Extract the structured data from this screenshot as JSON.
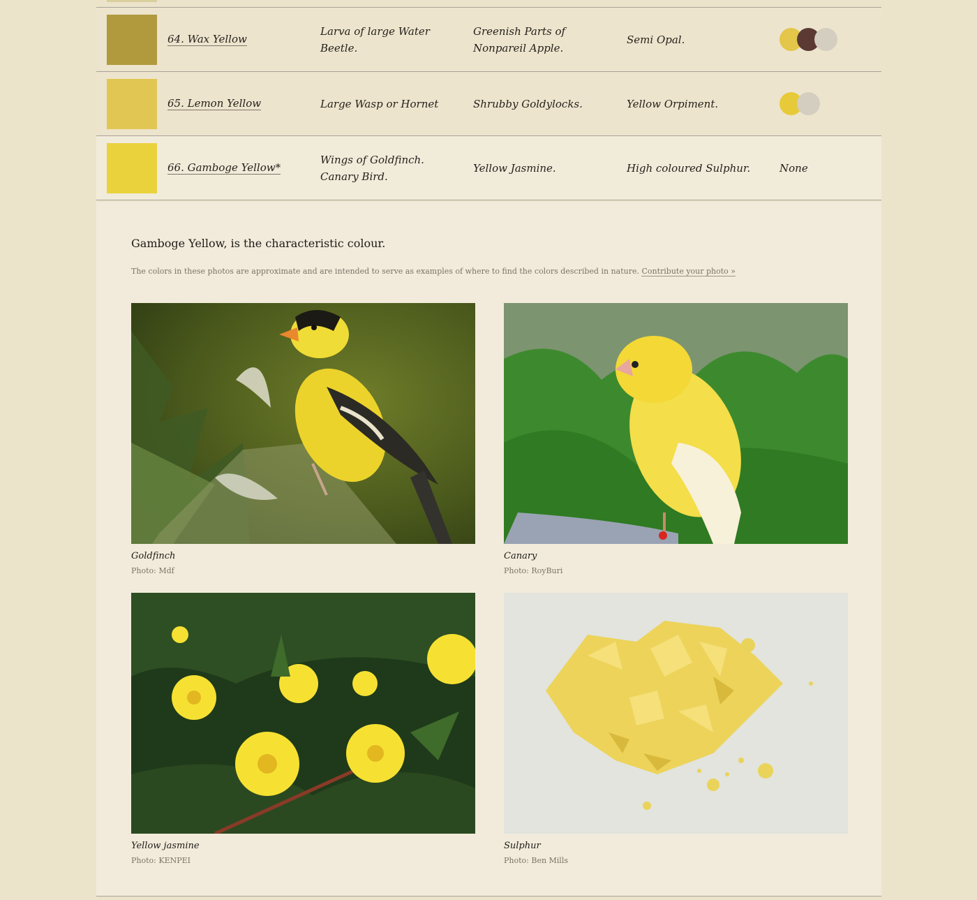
{
  "rows": [
    {
      "number_name": "64. Wax Yellow",
      "swatch_color": "#b09a3d",
      "animal": "Larva of large Water Beetle.",
      "vegetable": "Greenish Parts of Nonpareil Apple.",
      "mineral": "Semi Opal.",
      "dots": [
        "#e3c64a",
        "#5a3a33",
        "#d3cebf"
      ]
    },
    {
      "number_name": "65. Lemon Yellow",
      "swatch_color": "#e1c653",
      "animal": "Large Wasp or Hornet",
      "vegetable": "Shrubby Goldylocks.",
      "mineral": "Yellow Orpiment.",
      "dots": [
        "#e7ca3a",
        "#d3cebf"
      ]
    },
    {
      "number_name": "66. Gamboge Yellow*",
      "swatch_color": "#ead23c",
      "animal": "Wings of Goldfinch. Canary Bird.",
      "vegetable": "Yellow Jasmine.",
      "mineral": "High coloured Sulphur.",
      "dots_text": "None"
    }
  ],
  "detail": {
    "headline": "Gamboge Yellow, is the characteristic colour.",
    "note": "The colors in these photos are approximate and are intended to serve as examples of where to find the colors described in nature.",
    "contribute_link": "Contribute your photo »"
  },
  "photos": [
    {
      "caption": "Goldfinch",
      "credit": "Photo: Mdf",
      "icon": "goldfinch-photo"
    },
    {
      "caption": "Canary",
      "credit": "Photo: RoyBuri",
      "icon": "canary-photo"
    },
    {
      "caption": "Yellow jasmine",
      "credit": "Photo: KENPEI",
      "icon": "jasmine-photo"
    },
    {
      "caption": "Sulphur",
      "credit": "Photo: Ben Mills",
      "icon": "sulphur-photo"
    }
  ]
}
